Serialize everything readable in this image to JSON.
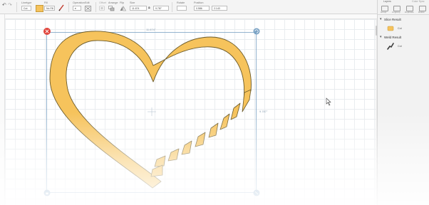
{
  "toolbar": {
    "undo_icon": "undo-icon",
    "redo_icon": "redo-icon",
    "linetype_label": "Linetype",
    "linetype_value": "Cut",
    "fill_label": "Fill",
    "fill_value": "No Fill",
    "operation_label": "Operation",
    "edit_label": "Edit",
    "offset_label": "Offset",
    "arrange_label": "Arrange",
    "flip_label": "Flip",
    "size_label": "Size",
    "width_value": "11.674",
    "height_value": "9.787",
    "rotate_label": "Rotate",
    "position_label": "Position",
    "x_value": "0.586",
    "y_value": "2.143",
    "fill_color": "#f6c35c",
    "pen_color": "#c0392b"
  },
  "canvas": {
    "width_readout": "11.674\"",
    "height_readout": "9.787\"",
    "shape_fill": "#f6c35c",
    "shape_stroke": "#6b5a2a",
    "selection_color": "#7aa2c4",
    "delete_handle_color": "#e0453c"
  },
  "panel": {
    "tabs": [
      "Layers",
      "Color Sync"
    ],
    "actions": [
      "Group",
      "Ungroup",
      "Duplicate",
      "Delete"
    ],
    "layers": [
      {
        "title": "Slice Result",
        "operation": "Cut",
        "thumb_color": "#f6c35c",
        "icon": "shape-thumbnail-icon"
      },
      {
        "title": "Weld Result",
        "operation": "Cut",
        "thumb_color": "#3a3a3a",
        "icon": "weld-shape-thumbnail-icon"
      }
    ]
  }
}
